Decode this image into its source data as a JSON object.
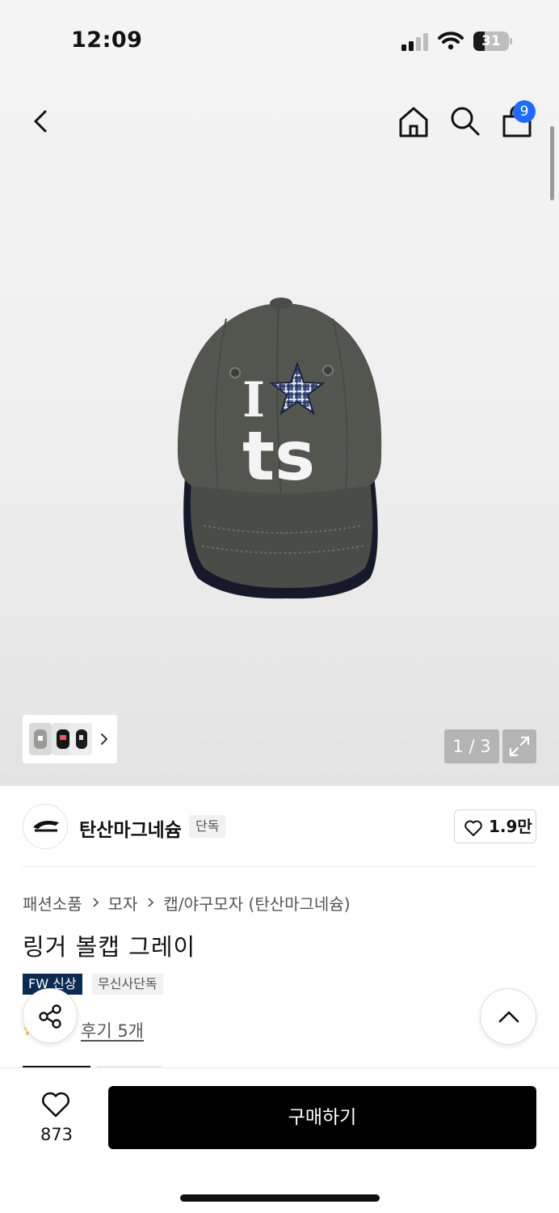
{
  "status_bar": {
    "time": "12:09",
    "battery_level": "31",
    "battery_fraction": 0.31
  },
  "header": {
    "cart_count": "9",
    "icons": [
      "back-icon",
      "home-icon",
      "search-icon",
      "shopping-bag-icon"
    ]
  },
  "gallery": {
    "counter": "1 / 3",
    "current_image": 1,
    "total_images": 3,
    "product_image_text": [
      "I",
      "ts"
    ]
  },
  "brand": {
    "name": "탄산마그네슘",
    "tag": "단독",
    "likes": "1.9만",
    "logo_text": "tansanmagnesium"
  },
  "breadcrumb": [
    "패션소품",
    "모자",
    "캡/야구모자 (탄산마그네슘)"
  ],
  "product": {
    "title": "링거 볼캡 그레이",
    "tags": [
      "FW 신상",
      "무신사단독"
    ],
    "reviews": "후기 5개"
  },
  "bottom_bar": {
    "wish_count": "873",
    "buy_label": "구매하기"
  },
  "colors": {
    "badge": "#1f6bff",
    "fw_tag": "#0d2b52",
    "buy_button": "#000000"
  }
}
